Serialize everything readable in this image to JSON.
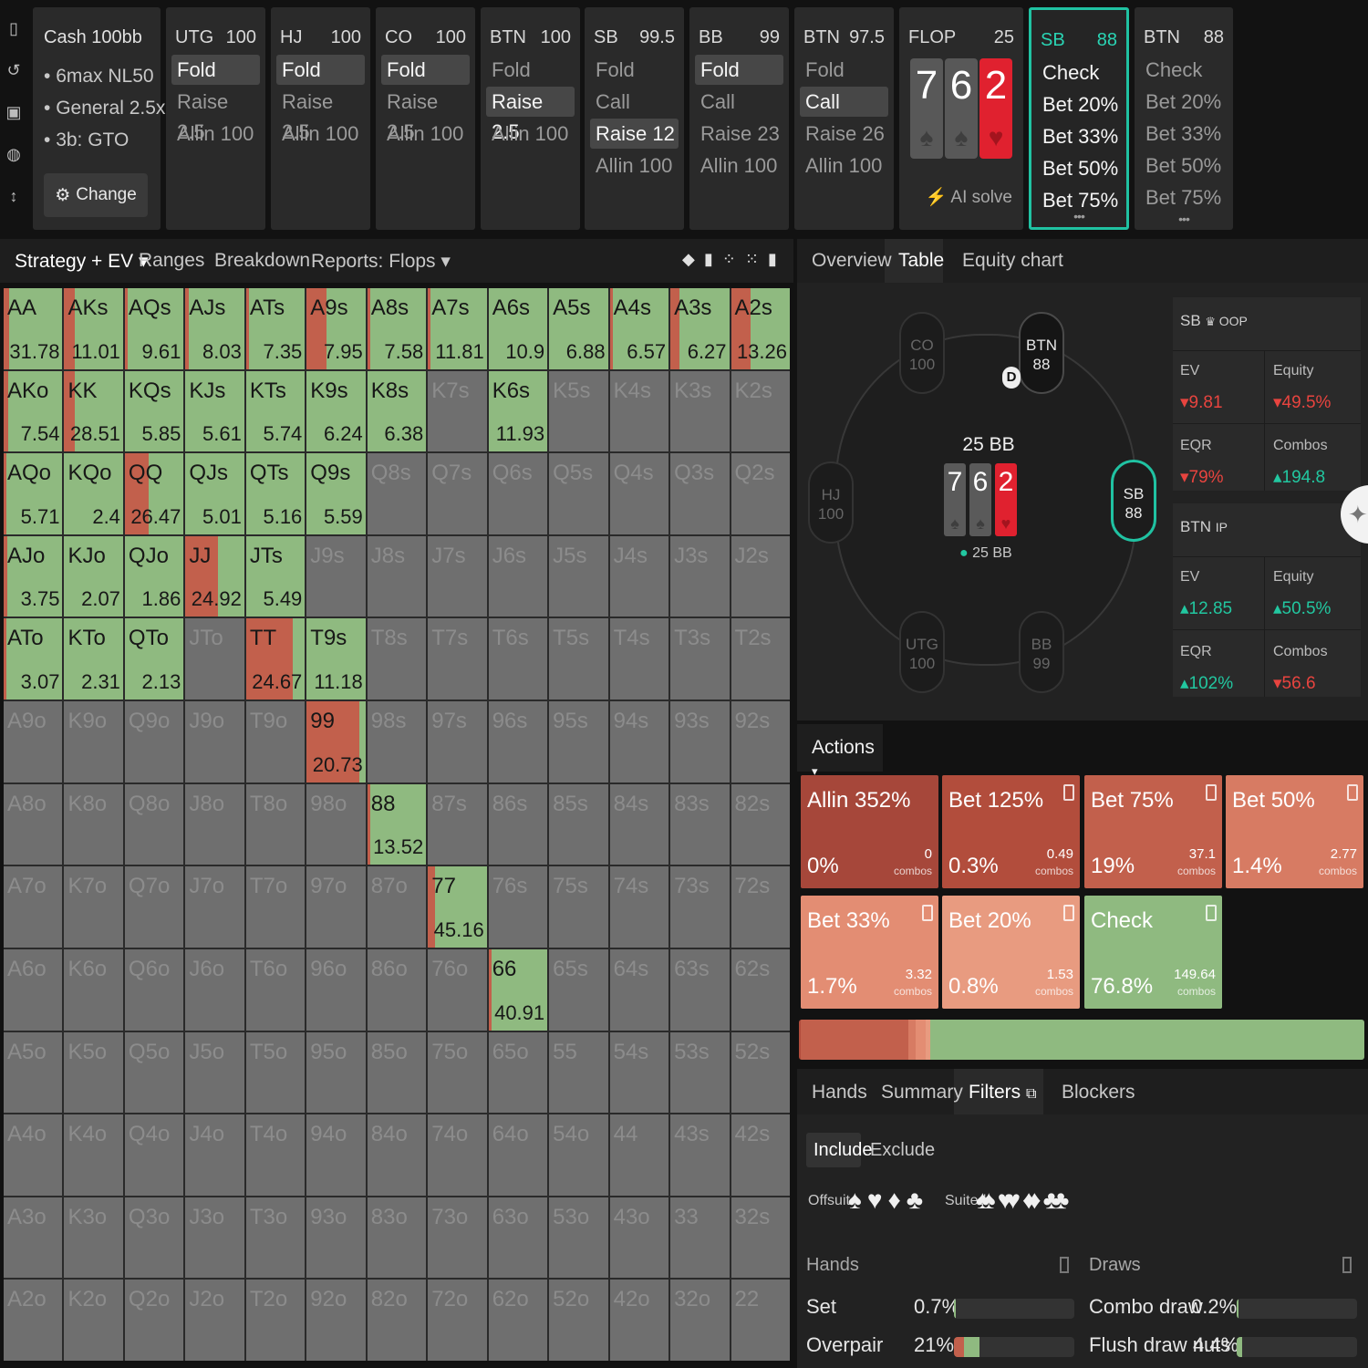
{
  "sidebar_icons": [
    "bookmark-icon",
    "history-icon",
    "save-icon",
    "gamepad-icon",
    "height-icon"
  ],
  "cash_panel": {
    "title": "Cash 100bb",
    "items": [
      "6max NL50",
      "General 2.5x",
      "3b: GTO"
    ],
    "change_label": "Change"
  },
  "positions": [
    {
      "pos": "UTG",
      "stack": "100",
      "actions": [
        "Fold",
        "Raise 2.5",
        "Allin 100"
      ],
      "selected": 0
    },
    {
      "pos": "HJ",
      "stack": "100",
      "actions": [
        "Fold",
        "Raise 2.5",
        "Allin 100"
      ],
      "selected": 0
    },
    {
      "pos": "CO",
      "stack": "100",
      "actions": [
        "Fold",
        "Raise 2.5",
        "Allin 100"
      ],
      "selected": 0
    },
    {
      "pos": "BTN",
      "stack": "100",
      "actions": [
        "Fold",
        "Raise 2.5",
        "Allin 100"
      ],
      "selected": 1
    },
    {
      "pos": "SB",
      "stack": "99.5",
      "actions": [
        "Fold",
        "Call",
        "Raise 12",
        "Allin 100"
      ],
      "selected": 2
    },
    {
      "pos": "BB",
      "stack": "99",
      "actions": [
        "Fold",
        "Call",
        "Raise 23",
        "Allin 100"
      ],
      "selected": 0
    },
    {
      "pos": "BTN",
      "stack": "97.5",
      "actions": [
        "Fold",
        "Call",
        "Raise 26",
        "Allin 100"
      ],
      "selected": 1
    }
  ],
  "flop": {
    "label": "FLOP",
    "pot": "25",
    "cards": [
      {
        "rank": "7",
        "suit": "♠"
      },
      {
        "rank": "6",
        "suit": "♠"
      },
      {
        "rank": "2",
        "suit": "♥"
      }
    ],
    "ai_solve": "AI solve"
  },
  "sb_panel": {
    "pos": "SB",
    "stack": "88",
    "actions": [
      "Check",
      "Bet 20%",
      "Bet 33%",
      "Bet 50%",
      "Bet 75%"
    ],
    "more": "•••"
  },
  "btn_panel": {
    "pos": "BTN",
    "stack": "88",
    "actions": [
      "Check",
      "Bet 20%",
      "Bet 33%",
      "Bet 50%",
      "Bet 75%"
    ],
    "more": "•••"
  },
  "left_tabs": [
    "Strategy + EV",
    "Ranges",
    "Breakdown",
    "Reports: Flops"
  ],
  "right_tabs": [
    "Overview",
    "Table",
    "Equity chart"
  ],
  "table_view": {
    "seats": [
      {
        "pos": "CO",
        "stack": "100"
      },
      {
        "pos": "BTN",
        "stack": "88"
      },
      {
        "pos": "HJ",
        "stack": "100"
      },
      {
        "pos": "SB",
        "stack": "88"
      },
      {
        "pos": "UTG",
        "stack": "100"
      },
      {
        "pos": "BB",
        "stack": "99"
      }
    ],
    "dealer": "D",
    "pot": "25 BB",
    "pot_small": "25 BB",
    "board": [
      {
        "rank": "7",
        "suit": "♠"
      },
      {
        "rank": "6",
        "suit": "♠"
      },
      {
        "rank": "2",
        "suit": "♥"
      }
    ]
  },
  "stats": {
    "sb": {
      "title": "SB",
      "tag": "OOP",
      "ev_label": "EV",
      "ev": "9.81",
      "equity_label": "Equity",
      "equity": "49.5%",
      "eqr_label": "EQR",
      "eqr": "79%",
      "combos_label": "Combos",
      "combos": "194.8"
    },
    "btn": {
      "title": "BTN",
      "tag": "IP",
      "ev_label": "EV",
      "ev": "12.85",
      "equity_label": "Equity",
      "equity": "50.5%",
      "eqr_label": "EQR",
      "eqr": "102%",
      "combos_label": "Combos",
      "combos": "56.6"
    }
  },
  "actions_header": "Actions",
  "action_boxes": [
    {
      "label": "Allin 352%",
      "pct": "0%",
      "combos": "0",
      "unit": "combos",
      "color": "#a6473a",
      "share": 0
    },
    {
      "label": "Bet 125%",
      "pct": "0.3%",
      "combos": "0.49",
      "unit": "combos",
      "color": "#b24d3c",
      "share": 0.3
    },
    {
      "label": "Bet 75%",
      "pct": "19%",
      "combos": "37.1",
      "unit": "combos",
      "color": "#c2604c",
      "share": 19
    },
    {
      "label": "Bet 50%",
      "pct": "1.4%",
      "combos": "2.77",
      "unit": "combos",
      "color": "#d77b63",
      "share": 1.4
    },
    {
      "label": "Bet 33%",
      "pct": "1.7%",
      "combos": "3.32",
      "unit": "combos",
      "color": "#e38d73",
      "share": 1.7
    },
    {
      "label": "Bet 20%",
      "pct": "0.8%",
      "combos": "1.53",
      "unit": "combos",
      "color": "#e89b80",
      "share": 0.8
    },
    {
      "label": "Check",
      "pct": "76.8%",
      "combos": "149.64",
      "unit": "combos",
      "color": "#8fba80",
      "share": 76.8
    }
  ],
  "bottom_tabs": [
    "Hands",
    "Summary",
    "Filters",
    "Blockers"
  ],
  "filters": {
    "include": "Include",
    "exclude": "Exclude",
    "offsuit": "Offsuit",
    "suited": "Suited",
    "offsuit_suits": [
      "♠",
      "♥",
      "♦",
      "♣"
    ],
    "suited_suits": [
      "♠♠",
      "♥♥",
      "♦♦",
      "♣♣"
    ]
  },
  "hands_stats": {
    "title": "Hands",
    "rows": [
      {
        "label": "Set",
        "value": "0.7%",
        "fill": 0.7
      },
      {
        "label": "Overpair",
        "value": "21%",
        "fill": 21
      }
    ]
  },
  "draws_stats": {
    "title": "Draws",
    "rows": [
      {
        "label": "Combo draw",
        "value": "0.2%",
        "fill": 0.2
      },
      {
        "label": "Flush draw nuts",
        "value": "4.4%",
        "fill": 4.4
      }
    ]
  },
  "grid": [
    [
      "AA",
      "AKs",
      "AQs",
      "AJs",
      "ATs",
      "A9s",
      "A8s",
      "A7s",
      "A6s",
      "A5s",
      "A4s",
      "A3s",
      "A2s"
    ],
    [
      "AKo",
      "KK",
      "KQs",
      "KJs",
      "KTs",
      "K9s",
      "K8s",
      "K7s",
      "K6s",
      "K5s",
      "K4s",
      "K3s",
      "K2s"
    ],
    [
      "AQo",
      "KQo",
      "QQ",
      "QJs",
      "QTs",
      "Q9s",
      "Q8s",
      "Q7s",
      "Q6s",
      "Q5s",
      "Q4s",
      "Q3s",
      "Q2s"
    ],
    [
      "AJo",
      "KJo",
      "QJo",
      "JJ",
      "JTs",
      "J9s",
      "J8s",
      "J7s",
      "J6s",
      "J5s",
      "J4s",
      "J3s",
      "J2s"
    ],
    [
      "ATo",
      "KTo",
      "QTo",
      "JTo",
      "TT",
      "T9s",
      "T8s",
      "T7s",
      "T6s",
      "T5s",
      "T4s",
      "T3s",
      "T2s"
    ],
    [
      "A9o",
      "K9o",
      "Q9o",
      "J9o",
      "T9o",
      "99",
      "98s",
      "97s",
      "96s",
      "95s",
      "94s",
      "93s",
      "92s"
    ],
    [
      "A8o",
      "K8o",
      "Q8o",
      "J8o",
      "T8o",
      "98o",
      "88",
      "87s",
      "86s",
      "85s",
      "84s",
      "83s",
      "82s"
    ],
    [
      "A7o",
      "K7o",
      "Q7o",
      "J7o",
      "T7o",
      "97o",
      "87o",
      "77",
      "76s",
      "75s",
      "74s",
      "73s",
      "72s"
    ],
    [
      "A6o",
      "K6o",
      "Q6o",
      "J6o",
      "T6o",
      "96o",
      "86o",
      "76o",
      "66",
      "65s",
      "64s",
      "63s",
      "62s"
    ],
    [
      "A5o",
      "K5o",
      "Q5o",
      "J5o",
      "T5o",
      "95o",
      "85o",
      "75o",
      "65o",
      "55",
      "54s",
      "53s",
      "52s"
    ],
    [
      "A4o",
      "K4o",
      "Q4o",
      "J4o",
      "T4o",
      "94o",
      "84o",
      "74o",
      "64o",
      "54o",
      "44",
      "43s",
      "42s"
    ],
    [
      "A3o",
      "K3o",
      "Q3o",
      "J3o",
      "T3o",
      "93o",
      "83o",
      "73o",
      "63o",
      "53o",
      "43o",
      "33",
      "32s"
    ],
    [
      "A2o",
      "K2o",
      "Q2o",
      "J2o",
      "T2o",
      "92o",
      "82o",
      "72o",
      "62o",
      "52o",
      "42o",
      "32o",
      "22"
    ]
  ],
  "grid_ev": {
    "AA": "31.78",
    "AKs": "11.01",
    "AQs": "9.61",
    "AJs": "8.03",
    "ATs": "7.35",
    "A9s": "7.95",
    "A8s": "7.58",
    "A7s": "11.81",
    "A6s": "10.9",
    "A5s": "6.88",
    "A4s": "6.57",
    "A3s": "6.27",
    "A2s": "13.26",
    "AKo": "7.54",
    "KK": "28.51",
    "KQs": "5.85",
    "KJs": "5.61",
    "KTs": "5.74",
    "K9s": "6.24",
    "K8s": "6.38",
    "K6s": "11.93",
    "AQo": "5.71",
    "KQo": "2.4",
    "QQ": "26.47",
    "QJs": "5.01",
    "QTs": "5.16",
    "Q9s": "5.59",
    "AJo": "3.75",
    "KJo": "2.07",
    "QJo": "1.86",
    "JJ": "24.92",
    "JTs": "5.49",
    "ATo": "3.07",
    "KTo": "2.31",
    "QTo": "2.13",
    "TT": "24.67",
    "T9s": "11.18",
    "99": "20.73",
    "88": "13.52",
    "77": "45.16",
    "66": "40.91"
  },
  "grid_bet": {
    "AA": 0.1,
    "AKs": 0.18,
    "AQs": 0.05,
    "AJs": 0.05,
    "ATs": 0.05,
    "A9s": 0.33,
    "A8s": 0.05,
    "A7s": 0.05,
    "A6s": 0.0,
    "A5s": 0.0,
    "A4s": 0.05,
    "A3s": 0.16,
    "A2s": 0.33,
    "AKo": 0.08,
    "KK": 0.18,
    "KQs": 0.0,
    "KJs": 0.0,
    "KTs": 0.0,
    "K9s": 0.0,
    "K8s": 0.0,
    "K6s": 0.0,
    "AQo": 0.05,
    "KQo": 0.0,
    "QQ": 0.4,
    "QJs": 0.0,
    "QTs": 0.0,
    "Q9s": 0.0,
    "AJo": 0.06,
    "KJo": 0.0,
    "QJo": 0.0,
    "JJ": 0.55,
    "JTs": 0.0,
    "ATo": 0.05,
    "KTo": 0.0,
    "QTo": 0.0,
    "TT": 0.8,
    "T9s": 0.0,
    "99": 0.9,
    "88": 0.05,
    "77": 0.12,
    "66": 0.05
  }
}
